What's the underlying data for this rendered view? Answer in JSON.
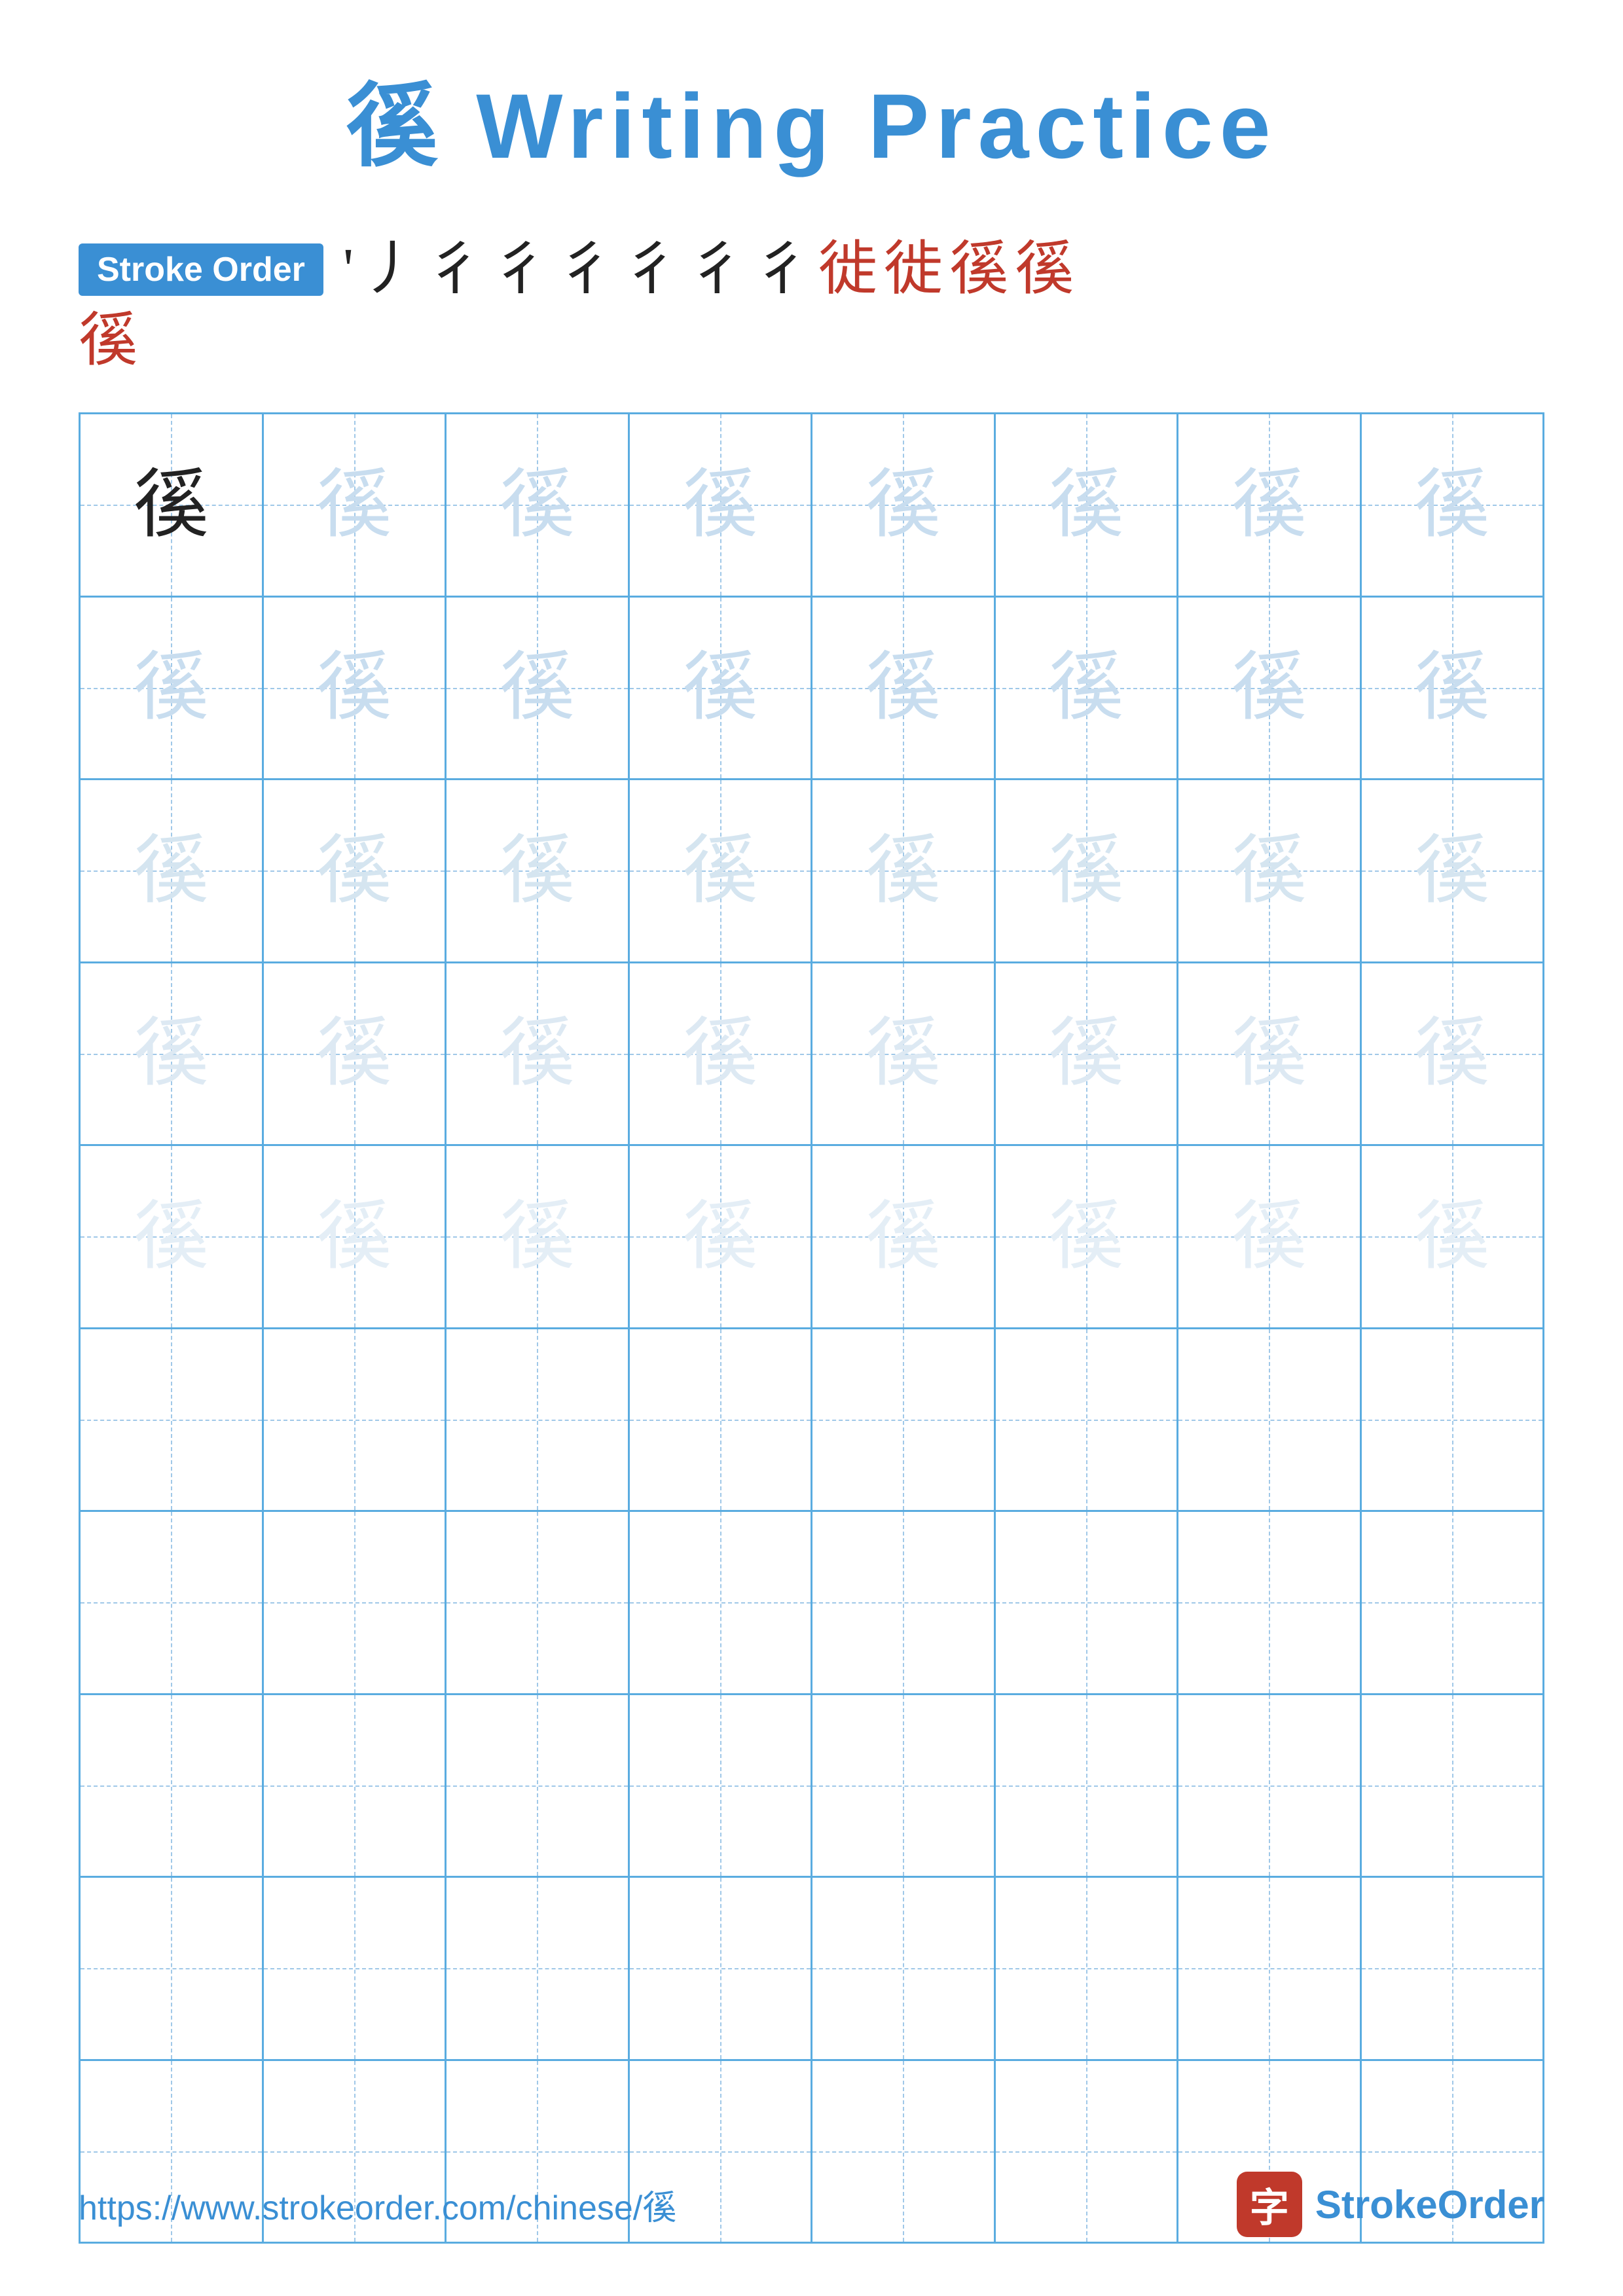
{
  "title": {
    "char": "徯",
    "label": "Writing Practice",
    "full": "徯 Writing Practice"
  },
  "stroke_order": {
    "badge_label": "Stroke Order",
    "strokes": [
      "'",
      "丿",
      "彳",
      "彳",
      "彳",
      "彳",
      "彳",
      "彳",
      "徙",
      "徙",
      "徯",
      "徯"
    ]
  },
  "practice_char": "徯",
  "grid": {
    "cols": 8,
    "rows": 10,
    "char_rows": 5,
    "empty_rows": 5
  },
  "footer": {
    "url": "https://www.strokeorder.com/chinese/徯",
    "brand": "StrokeOrder",
    "logo_char": "字"
  },
  "colors": {
    "blue": "#3a8fd4",
    "red": "#c0392b",
    "grid_border": "#5aace0",
    "guide_line": "#a0c8e8"
  }
}
